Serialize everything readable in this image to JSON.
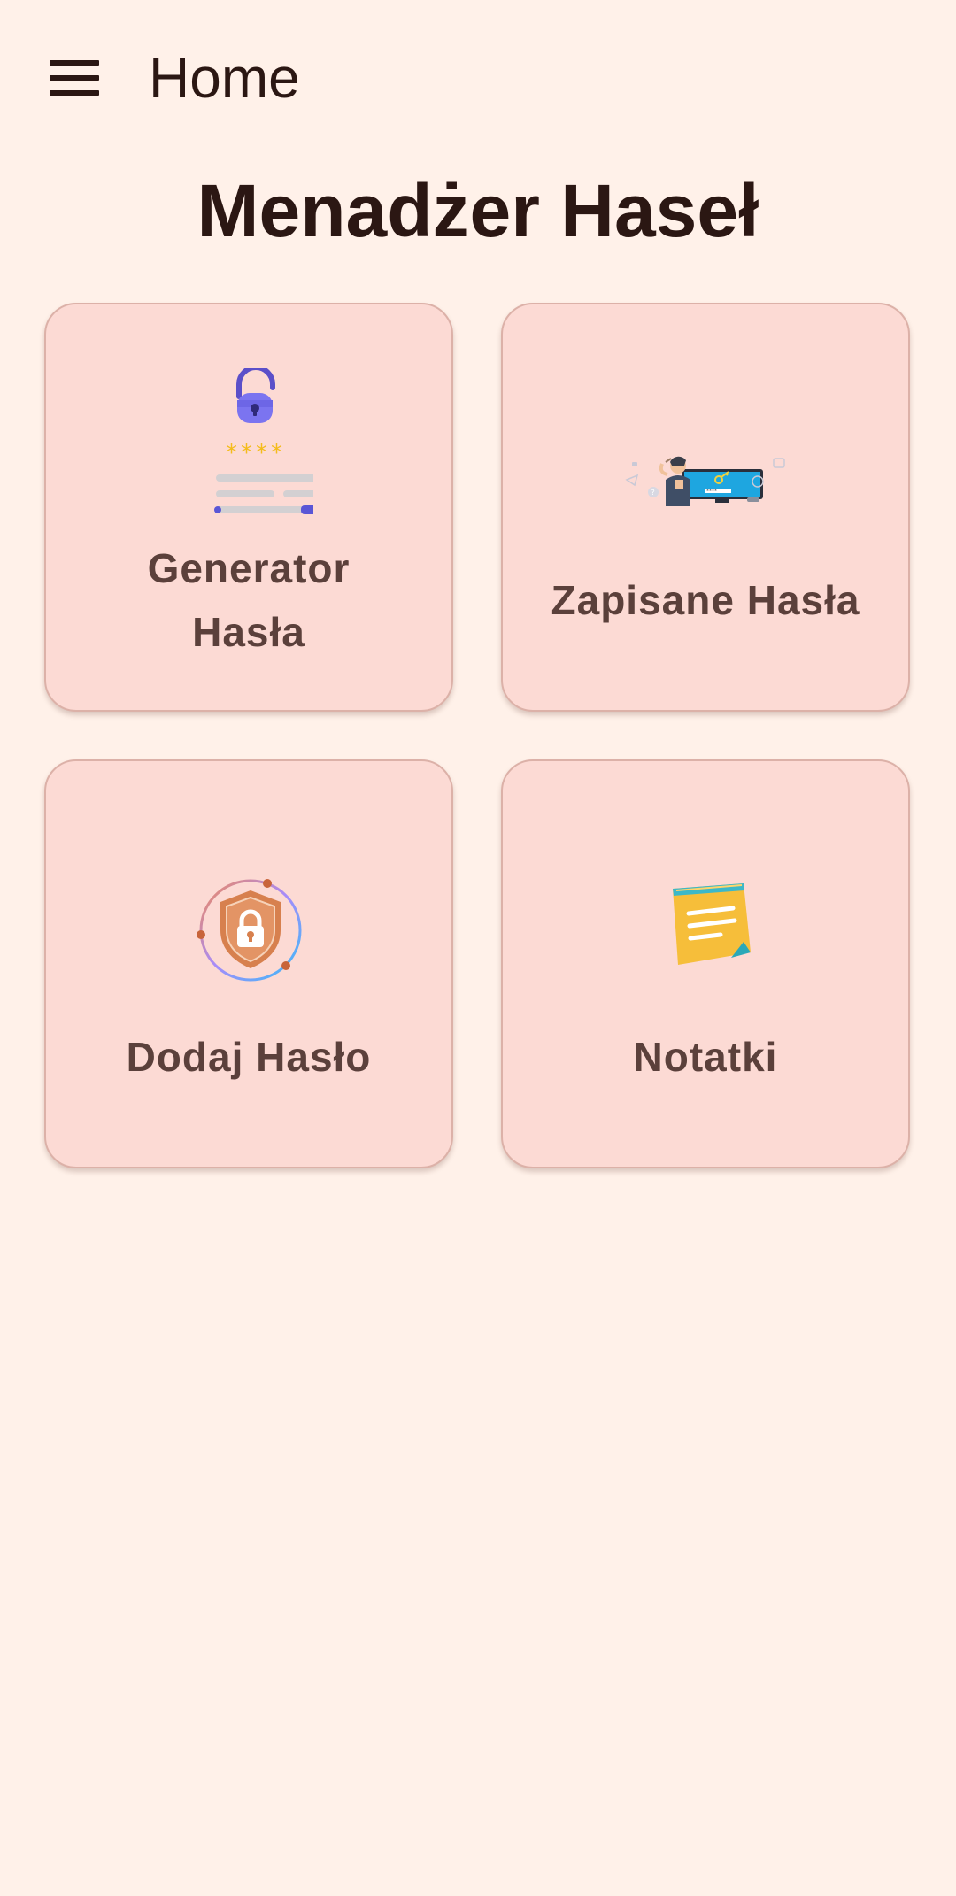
{
  "topbar": {
    "menu_icon": "hamburger-menu-icon",
    "title": "Home"
  },
  "page": {
    "heading": "Menadżer Haseł"
  },
  "cards": [
    {
      "label_line1": "Generator",
      "label_line2": "Hasła",
      "icon": "password-generator-icon"
    },
    {
      "label": "Zapisane Hasła",
      "icon": "saved-passwords-illustration-icon"
    },
    {
      "label": "Dodaj Hasło",
      "icon": "shield-lock-icon"
    },
    {
      "label": "Notatki",
      "icon": "sticky-note-icon"
    }
  ],
  "colors": {
    "background": "#fff1e9",
    "card": "#fcdad4",
    "card_border": "#dcb1a8",
    "text_dark": "#2b1713",
    "card_text": "#5b403b"
  }
}
